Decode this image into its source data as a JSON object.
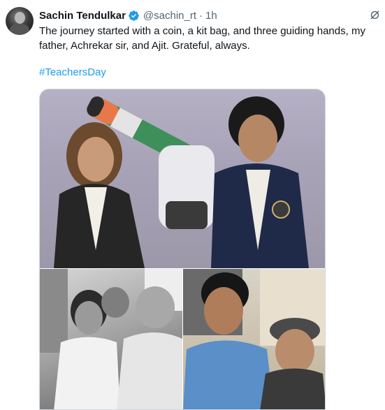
{
  "tweet": {
    "author_name": "Sachin Tendulkar",
    "handle": "@sachin_rt",
    "separator": "·",
    "time_ago": "1h",
    "text": "The journey started with a coin, a kit bag, and three guiding hands, my father, Achrekar sir, and Ajit. Grateful, always.",
    "hashtag": "#TeachersDay"
  },
  "icons": {
    "verified": "verified-badge-icon",
    "grok": "grok-icon"
  },
  "colors": {
    "text": "#0f1419",
    "secondary": "#536471",
    "link": "#1d9bf0",
    "verified": "#1d9bf0"
  }
}
